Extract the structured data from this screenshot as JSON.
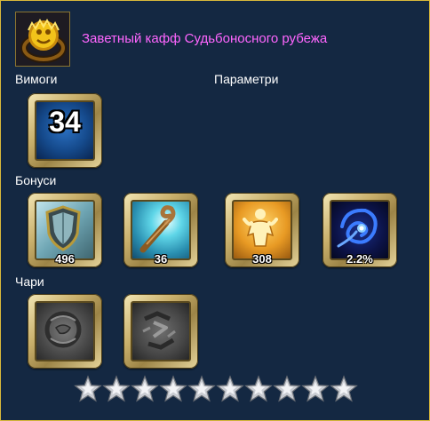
{
  "item": {
    "name": "Заветный кафф Судьбоносного рубежа",
    "icon": "golden-lion-ring-icon"
  },
  "sections": {
    "requirements_label": "Вимоги",
    "parameters_label": "Параметри",
    "bonuses_label": "Бонуси",
    "charms_label": "Чари"
  },
  "requirements": [
    {
      "icon": "level-icon",
      "value": "34"
    }
  ],
  "bonuses": [
    {
      "icon": "shield-icon",
      "value": "496"
    },
    {
      "icon": "magic-staff-icon",
      "value": "36"
    },
    {
      "icon": "golden-figure-icon",
      "value": "308"
    },
    {
      "icon": "blue-swirl-icon",
      "value": "2.2%"
    }
  ],
  "charms": [
    {
      "icon": "empty-stone-charm-icon"
    },
    {
      "icon": "runed-stone-charm-icon"
    }
  ],
  "stars": {
    "total": 10,
    "filled": 0,
    "icon": "silver-star-icon"
  },
  "colors": {
    "background": "#142842",
    "border": "#d9b93a",
    "item_name": "#ff66ff",
    "label": "#ffffff"
  }
}
